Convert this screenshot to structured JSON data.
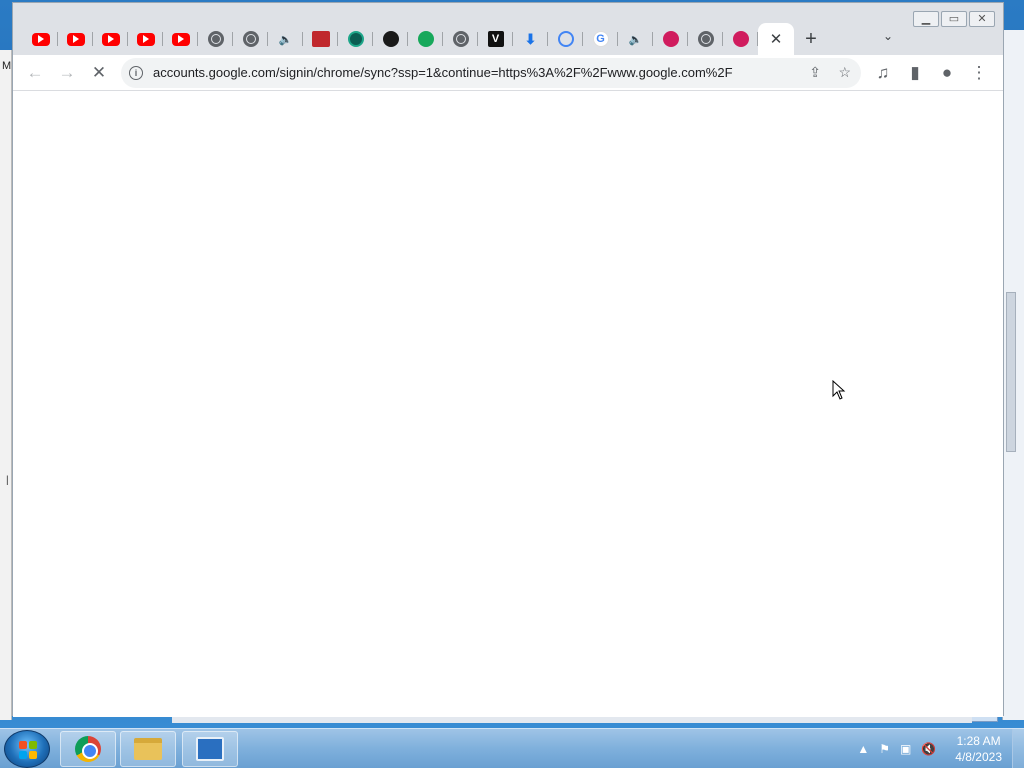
{
  "browser": {
    "tabs": [
      {
        "icon": "youtube-icon",
        "type": "yt"
      },
      {
        "icon": "youtube-icon",
        "type": "yt"
      },
      {
        "icon": "youtube-icon",
        "type": "yt"
      },
      {
        "icon": "youtube-icon",
        "type": "yt"
      },
      {
        "icon": "youtube-icon",
        "type": "yt"
      },
      {
        "icon": "globe-icon",
        "type": "globe"
      },
      {
        "icon": "globe-icon",
        "type": "globe"
      },
      {
        "icon": "speaker-icon",
        "type": "spk"
      },
      {
        "icon": "red-dots-icon",
        "type": "red-sq"
      },
      {
        "icon": "teal-circle-icon",
        "type": "teal"
      },
      {
        "icon": "dark-circle-icon",
        "type": "dark"
      },
      {
        "icon": "green-robot-icon",
        "type": "green"
      },
      {
        "icon": "globe-icon",
        "type": "globe"
      },
      {
        "icon": "v-logo-icon",
        "type": "v",
        "text": "V"
      },
      {
        "icon": "download-icon",
        "type": "dl",
        "text": "⬇"
      },
      {
        "icon": "google-lens-icon",
        "type": "lens"
      },
      {
        "icon": "google-icon",
        "type": "g",
        "text": "G"
      },
      {
        "icon": "speaker-icon",
        "type": "spk"
      },
      {
        "icon": "pink-circle-icon",
        "type": "pink"
      },
      {
        "icon": "globe-icon",
        "type": "globe"
      },
      {
        "icon": "pink-circle-icon",
        "type": "pink"
      }
    ],
    "active_tab_close": "✕",
    "new_tab": "+",
    "tab_search": "⌄",
    "window_controls": {
      "minimize": "▁",
      "maximize": "▭",
      "close": "✕"
    },
    "toolbar": {
      "back": "←",
      "forward": "→",
      "stop": "✕",
      "url": "accounts.google.com/signin/chrome/sync?ssp=1&continue=https%3A%2F%2Fwww.google.com%2F",
      "info": "i",
      "share": "⇪",
      "bookmark": "☆",
      "media": "♫",
      "side_panel": "▮",
      "profile": "●",
      "menu": "⋮"
    }
  },
  "taskbar": {
    "clock_time": "1:28 AM",
    "clock_date": "4/8/2023",
    "tray_icons": [
      "▲",
      "⚑",
      "▣",
      "🔇"
    ]
  },
  "colors": {
    "tabstrip": "#dee1e6",
    "taskbar": "#7fb0dc",
    "desktop": "#2b7bc4"
  }
}
